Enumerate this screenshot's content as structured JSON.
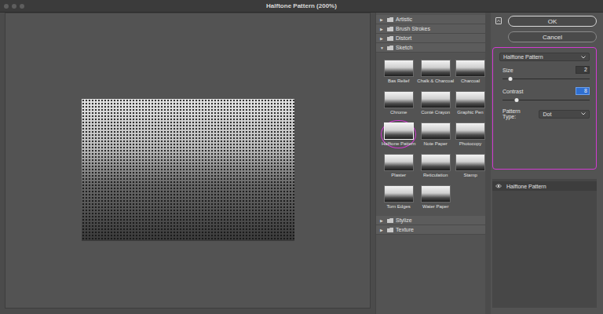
{
  "window": {
    "title": "Halftone Pattern (200%)"
  },
  "categories": [
    {
      "label": "Artistic",
      "arrow": "▶",
      "expanded": false,
      "filters": []
    },
    {
      "label": "Brush Strokes",
      "arrow": "▶",
      "expanded": false,
      "filters": []
    },
    {
      "label": "Distort",
      "arrow": "▶",
      "expanded": false,
      "filters": []
    },
    {
      "label": "Sketch",
      "arrow": "▼",
      "expanded": true,
      "filters": [
        {
          "label": "Bas Relief",
          "selected": false,
          "circled": false
        },
        {
          "label": "Chalk & Charcoal",
          "selected": false,
          "circled": false
        },
        {
          "label": "Charcoal",
          "selected": false,
          "circled": false
        },
        {
          "label": "Chrome",
          "selected": false,
          "circled": false
        },
        {
          "label": "Conté Crayon",
          "selected": false,
          "circled": false
        },
        {
          "label": "Graphic Pen",
          "selected": false,
          "circled": false
        },
        {
          "label": "Halftone Pattern",
          "selected": true,
          "circled": true
        },
        {
          "label": "Note Paper",
          "selected": false,
          "circled": false
        },
        {
          "label": "Photocopy",
          "selected": false,
          "circled": false
        },
        {
          "label": "Plaster",
          "selected": false,
          "circled": false
        },
        {
          "label": "Reticulation",
          "selected": false,
          "circled": false
        },
        {
          "label": "Stamp",
          "selected": false,
          "circled": false
        },
        {
          "label": "Torn Edges",
          "selected": false,
          "circled": false
        },
        {
          "label": "Water Paper",
          "selected": false,
          "circled": false
        }
      ]
    },
    {
      "label": "Stylize",
      "arrow": "▶",
      "expanded": false,
      "filters": []
    },
    {
      "label": "Texture",
      "arrow": "▶",
      "expanded": false,
      "filters": []
    }
  ],
  "buttons": [
    {
      "label": "OK",
      "primary": true
    },
    {
      "label": "Cancel",
      "primary": false
    }
  ],
  "settings": {
    "filter": "Halftone Pattern",
    "circled": true,
    "sliders": [
      {
        "label": "Size",
        "value": "2",
        "level": 0.09,
        "focused": false
      },
      {
        "label": "Contrast",
        "value": "8",
        "level": 0.16,
        "focused": true
      }
    ],
    "pattern_type": {
      "label": "Pattern Type:",
      "value": "Dot"
    }
  },
  "layers": [
    {
      "label": "Halftone Pattern",
      "visible": true
    }
  ]
}
